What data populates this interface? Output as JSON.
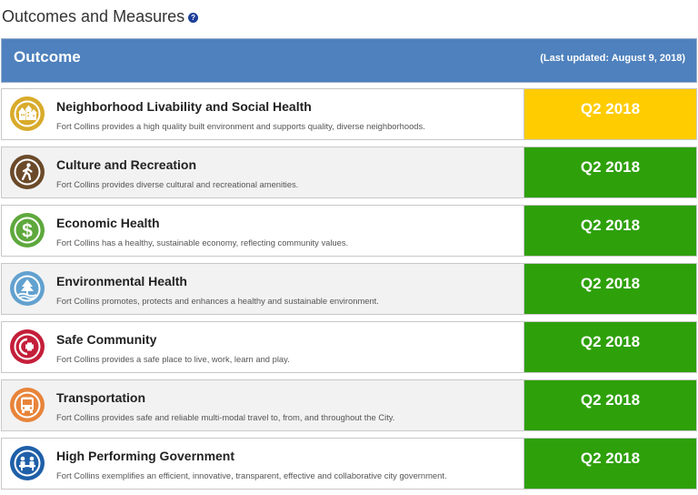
{
  "page": {
    "title": "Outcomes and Measures",
    "help_icon": "question-circle-icon"
  },
  "header": {
    "title": "Outcome",
    "updated": "(Last updated: August 9, 2018)",
    "color": "#4e81bd"
  },
  "colors": {
    "yellow": "#ffcc00",
    "green": "#2ea00a"
  },
  "outcomes": [
    {
      "title": "Neighborhood Livability and Social Health",
      "description": "Fort Collins provides a high quality built environment and supports quality, diverse neighborhoods.",
      "status": "Q2 2018",
      "status_color": "yellow",
      "icon": "neighborhood-houses-icon",
      "icon_color": "#d9ab2b"
    },
    {
      "title": "Culture and Recreation",
      "description": "Fort Collins provides diverse cultural and recreational amenities.",
      "status": "Q2 2018",
      "status_color": "green",
      "icon": "walking-person-icon",
      "icon_color": "#6b4a2a"
    },
    {
      "title": "Economic Health",
      "description": "Fort Collins has a healthy, sustainable economy, reflecting community values.",
      "status": "Q2 2018",
      "status_color": "green",
      "icon": "dollar-sign-icon",
      "icon_color": "#5ea83d"
    },
    {
      "title": "Environmental Health",
      "description": "Fort Collins promotes, protects and enhances a healthy and sustainable environment.",
      "status": "Q2 2018",
      "status_color": "green",
      "icon": "tree-water-icon",
      "icon_color": "#62a1cf"
    },
    {
      "title": "Safe Community",
      "description": "Fort Collins provides a safe place to live, work, learn and play.",
      "status": "Q2 2018",
      "status_color": "green",
      "icon": "medical-cross-icon",
      "icon_color": "#c41f3a"
    },
    {
      "title": "Transportation",
      "description": "Fort Collins provides safe and reliable multi-modal travel to, from, and throughout the City.",
      "status": "Q2 2018",
      "status_color": "green",
      "icon": "bus-icon",
      "icon_color": "#e8843a"
    },
    {
      "title": "High Performing Government",
      "description": "Fort Collins exemplifies an efficient, innovative, transparent, effective and collaborative city government.",
      "status": "Q2 2018",
      "status_color": "green",
      "icon": "government-people-icon",
      "icon_color": "#1f5fa8"
    }
  ]
}
